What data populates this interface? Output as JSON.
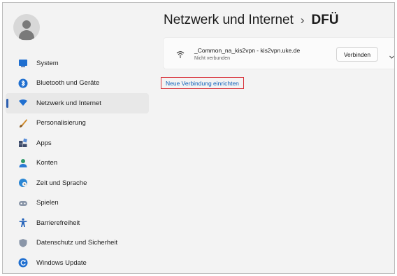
{
  "header": {
    "title": "Netzwerk und Internet",
    "separator": "›",
    "current": "DFÜ"
  },
  "sidebar": {
    "active_index": 2,
    "items": [
      {
        "label": "System",
        "icon": "monitor-icon"
      },
      {
        "label": "Bluetooth und Geräte",
        "icon": "bluetooth-icon"
      },
      {
        "label": "Netzwerk und Internet",
        "icon": "network-icon"
      },
      {
        "label": "Personalisierung",
        "icon": "brush-icon"
      },
      {
        "label": "Apps",
        "icon": "apps-icon"
      },
      {
        "label": "Konten",
        "icon": "person-icon"
      },
      {
        "label": "Zeit und Sprache",
        "icon": "globe-clock-icon"
      },
      {
        "label": "Spielen",
        "icon": "gamepad-icon"
      },
      {
        "label": "Barrierefreiheit",
        "icon": "accessibility-icon"
      },
      {
        "label": "Datenschutz und Sicherheit",
        "icon": "shield-icon"
      },
      {
        "label": "Windows Update",
        "icon": "update-icon"
      }
    ]
  },
  "vpn": {
    "name": "_Common_na_kis2vpn - kis2vpn.uke.de",
    "status": "Nicht verbunden",
    "connect_label": "Verbinden"
  },
  "actions": {
    "new_connection": "Neue Verbindung einrichten"
  },
  "colors": {
    "accent": "#2d5fb0",
    "link": "#0f5fb8",
    "highlight_border": "#d8323a"
  }
}
